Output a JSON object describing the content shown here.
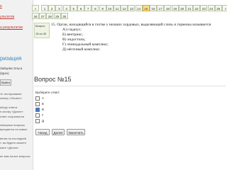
{
  "sidebar": {
    "link_top": "е",
    "link1": "ультатов",
    "link2": "а результатов",
    "heading": "ризация",
    "user_name": "Зайцева Ольга",
    "user_role": "(врач)",
    "logout": "Выйти",
    "help_lines": [
      "те тестирование",
      "кнопку «Начать»",
      "",
      "ибору ответа",
      "е кнопку «Далее»",
      "ответ сохраняется",
      "",
      "неверные вопросы",
      "вращается на новые",
      "",
      "ветив на последний",
      "т, вы будете можете",
      "мите «Далее»",
      "",
      "ие вам на все вопросы"
    ]
  },
  "pager": {
    "row1": [
      "1",
      "2",
      "3",
      "4",
      "5",
      "6",
      "7",
      "8",
      "9",
      "10",
      "11",
      "12",
      "13",
      "14",
      "15",
      "16",
      "17",
      "18",
      "19",
      "20",
      "21",
      "22",
      "23",
      "24",
      "25"
    ],
    "row2": [
      "26",
      "27",
      "28",
      "29",
      "30"
    ],
    "current": "15",
    "prev_symbol": "«",
    "next_symbol": "»"
  },
  "question_cell": {
    "label": "Вопрос",
    "number": "15 из 30"
  },
  "question": {
    "text": "15. Орган, находящийся в глотке у низших хордовых, выделяющий слизь и гормоны называется",
    "options": [
      "А) гладиус;",
      "Б) вентрикс;",
      "В) эндостиль;",
      "Г) эпинодальный комплекс;",
      "Д) нёгочный комплекс."
    ]
  },
  "title": "Вопрос №15",
  "answer": {
    "prompt": "Выберите ответ:",
    "choices": [
      "А",
      "Б",
      "В",
      "Г",
      "Д"
    ],
    "selected": "В"
  },
  "buttons": {
    "back": "Назад",
    "next": "Далее",
    "finish": "Закончить"
  }
}
